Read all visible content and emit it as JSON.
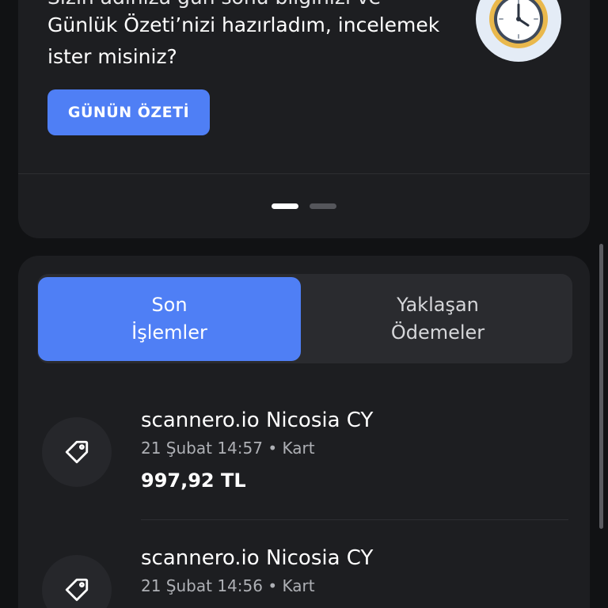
{
  "summary": {
    "text_line_partial": "Sizin adınıza gün sonu bilginizi ve",
    "text_line_1": "Günlük Özeti’nizi hazırladım, incelemek",
    "text_line_2": "ister misiniz?",
    "button_label": "GÜNÜN ÖZETİ",
    "icon": "clock-icon"
  },
  "tabs": [
    {
      "label_line_1": "Son",
      "label_line_2": "İşlemler",
      "active": true
    },
    {
      "label_line_1": "Yaklaşan",
      "label_line_2": "Ödemeler",
      "active": false
    }
  ],
  "transactions": [
    {
      "title": "scannero.io Nicosia CY",
      "meta": "21 Şubat 14:57 • Kart",
      "amount": "997,92 TL",
      "icon": "tag-icon"
    },
    {
      "title": "scannero.io Nicosia CY",
      "meta": "21 Şubat 14:56 • Kart",
      "icon": "tag-icon"
    }
  ],
  "colors": {
    "accent": "#4f7ff5",
    "background": "#111214",
    "card": "#1d1e21"
  }
}
